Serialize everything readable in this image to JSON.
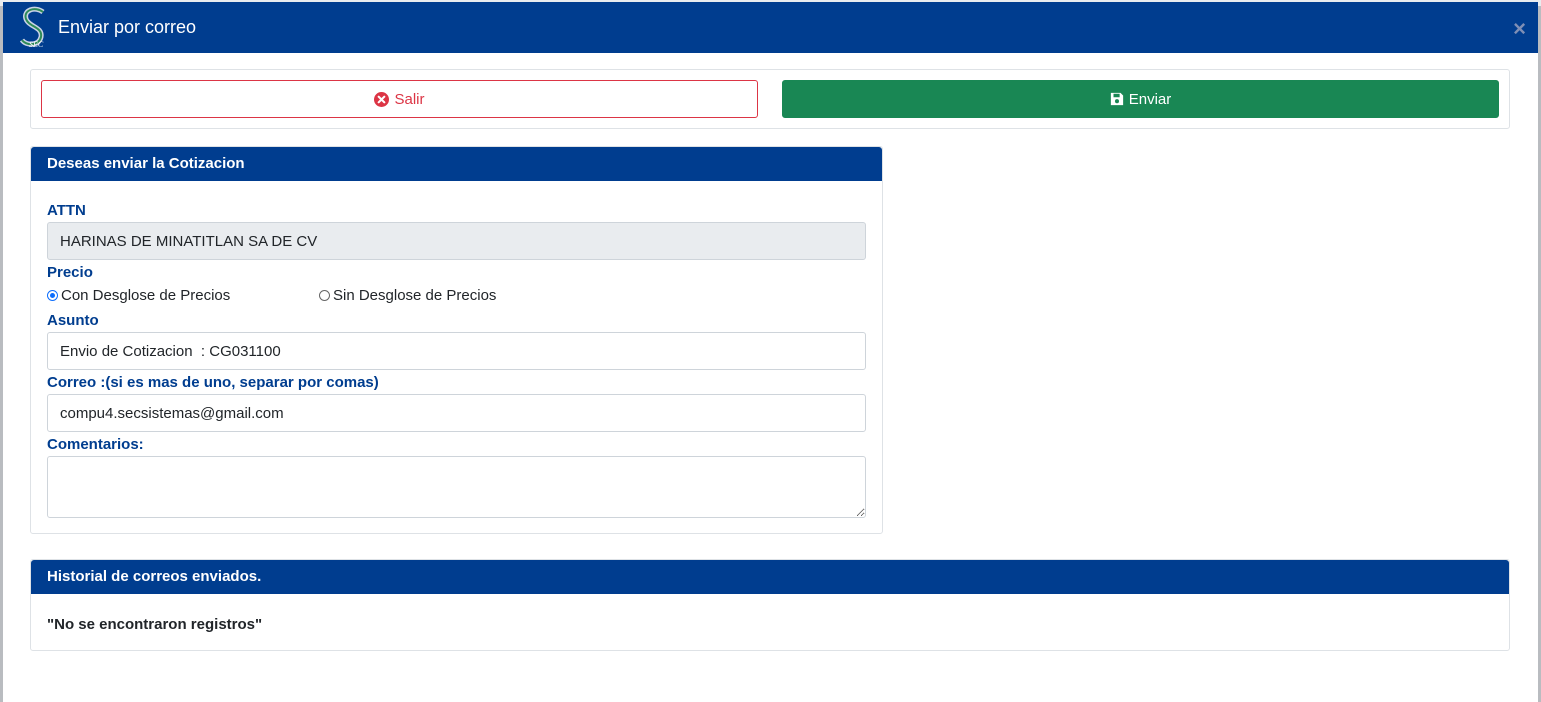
{
  "window": {
    "title": "Enviar por correo",
    "close_label": "×"
  },
  "actions": {
    "exit_label": "Salir",
    "send_label": "Enviar"
  },
  "form_card": {
    "header": "Deseas enviar la Cotizacion",
    "attn_label": "ATTN",
    "attn_value": "HARINAS DE MINATITLAN SA DE CV",
    "price_label": "Precio",
    "price_options": [
      {
        "label": "Con Desglose de Precios",
        "selected": true
      },
      {
        "label": "Sin Desglose de Precios",
        "selected": false
      }
    ],
    "subject_label": "Asunto",
    "subject_value": "Envio de Cotizacion  : CG031100",
    "email_label": "Correo :(si es mas de uno, separar por comas)",
    "email_value": "compu4.secsistemas@gmail.com",
    "comments_label": "Comentarios:",
    "comments_value": ""
  },
  "history_card": {
    "header": "Historial de correos enviados.",
    "empty_text": "\"No se encontraron registros\""
  },
  "colors": {
    "primary": "#003d8f",
    "success": "#198754",
    "danger": "#dc3545"
  }
}
